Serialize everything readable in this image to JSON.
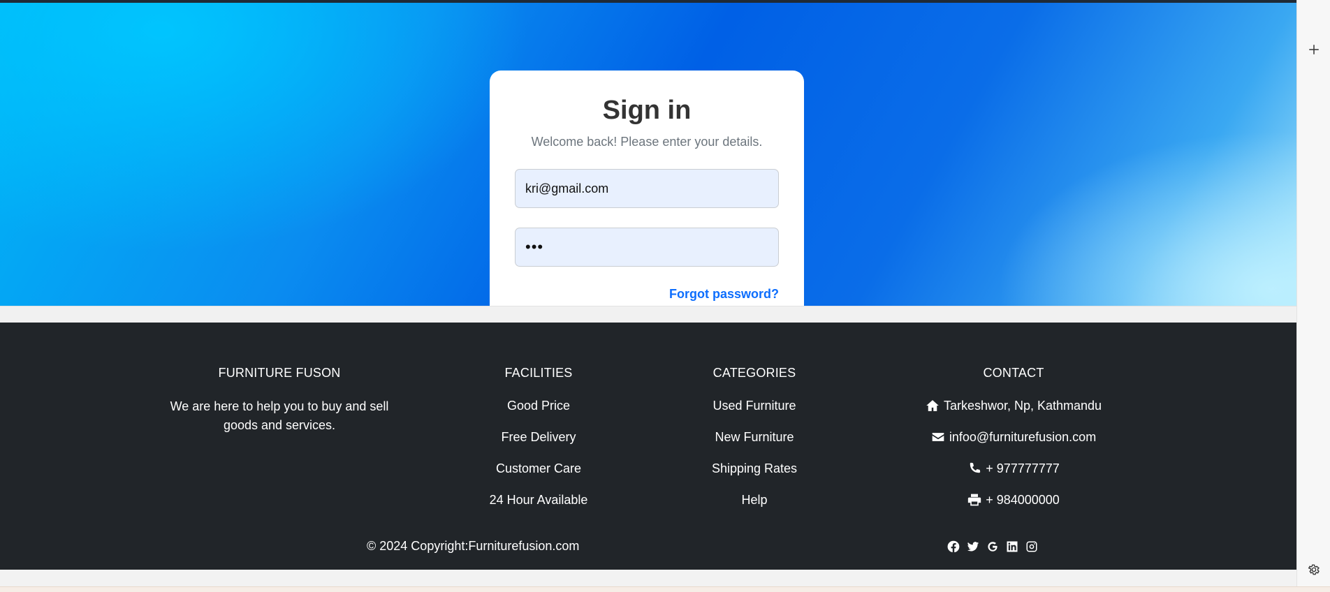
{
  "signin": {
    "title": "Sign in",
    "subtitle": "Welcome back! Please enter your details.",
    "email_value": "kri@gmail.com",
    "password_value": "•••",
    "forgot_label": "Forgot password?"
  },
  "footer": {
    "brand": {
      "heading": "FURNITURE FUSON",
      "text": "We are here to help you to buy and sell goods and services."
    },
    "facilities": {
      "heading": "FACILITIES",
      "items": [
        "Good Price",
        "Free Delivery",
        "Customer Care",
        "24 Hour Available"
      ]
    },
    "categories": {
      "heading": "CATEGORIES",
      "items": [
        "Used Furniture",
        "New Furniture",
        "Shipping Rates",
        "Help"
      ]
    },
    "contact": {
      "heading": "CONTACT",
      "items": [
        {
          "icon": "home-icon",
          "text": "Tarkeshwor, Np, Kathmandu"
        },
        {
          "icon": "envelope-icon",
          "text": "infoo@furniturefusion.com"
        },
        {
          "icon": "phone-icon",
          "text": "+ 977777777"
        },
        {
          "icon": "print-icon",
          "text": "+ 984000000"
        }
      ]
    },
    "copyright": "© 2024 Copyright:Furniturefusion.com",
    "socials": [
      "facebook-icon",
      "twitter-icon",
      "google-icon",
      "linkedin-icon",
      "instagram-icon"
    ]
  },
  "colors": {
    "footer_bg": "#212529",
    "link_blue": "#0d6efd",
    "input_bg": "#e8f0fe"
  },
  "sidebar": {
    "icons": [
      "plus-icon",
      "gear-icon"
    ]
  }
}
